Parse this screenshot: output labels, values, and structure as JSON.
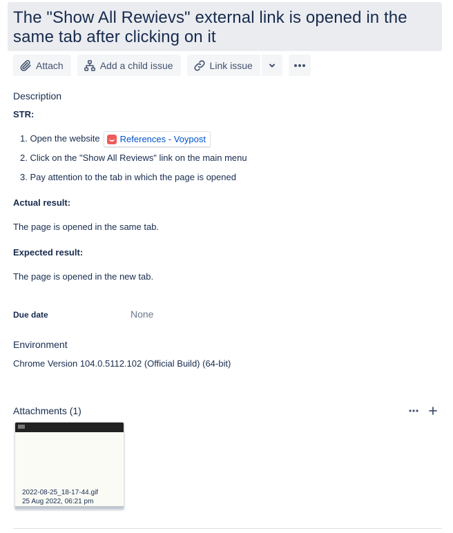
{
  "issue": {
    "title": "The \"Show All Rewievs\" external link is opened in the same tab after clicking on it"
  },
  "toolbar": {
    "attach_label": "Attach",
    "add_child_label": "Add a child issue",
    "link_issue_label": "Link issue",
    "icons": [
      "paperclip-icon",
      "child-issue-icon",
      "link-icon",
      "chevron-down-icon",
      "more-icon"
    ]
  },
  "description": {
    "heading": "Description",
    "str_label": "STR:",
    "steps": [
      {
        "number": "1.",
        "text": "Open the website",
        "link_text": "References - Voypost"
      },
      {
        "number": "2.",
        "text": "Click on the \"Show All Reviews\" link on the main menu"
      },
      {
        "number": "3.",
        "text": "Pay attention to the tab in which the page is opened"
      }
    ],
    "actual_label": "Actual result:",
    "actual_text": "The page is opened in the same tab.",
    "expected_label": "Expected result:",
    "expected_text": "The page is opened in the new tab."
  },
  "due_date": {
    "label": "Due date",
    "value": "None"
  },
  "environment": {
    "label": "Environment",
    "value": "Chrome Version 104.0.5112.102 (Official Build) (64-bit)"
  },
  "attachments": {
    "heading": "Attachments (1)",
    "items": [
      {
        "filename": "2022-08-25_18-17-44.gif",
        "date": "25 Aug 2022, 06:21 pm"
      }
    ]
  },
  "colors": {
    "text": "#172b4d",
    "muted": "#6b778c",
    "link": "#0052cc",
    "button_bg": "#f4f5f7",
    "title_bg": "#ebecf0",
    "favicon": "#f05a5a"
  }
}
